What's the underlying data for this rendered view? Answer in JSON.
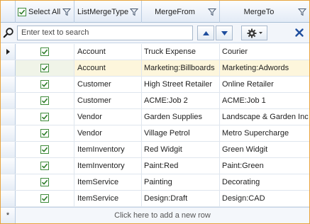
{
  "header": {
    "select_all_label": "Select All",
    "columns": [
      "ListMergeType",
      "MergeFrom",
      "MergeTo"
    ]
  },
  "search": {
    "placeholder": "Enter text to search"
  },
  "rows": [
    {
      "checked": true,
      "type": "Account",
      "from": "Truck Expense",
      "to": "Courier"
    },
    {
      "checked": true,
      "type": "Account",
      "from": "Marketing:Billboards",
      "to": "Marketing:Adwords"
    },
    {
      "checked": true,
      "type": "Customer",
      "from": "High Street Retailer",
      "to": "Online Retailer"
    },
    {
      "checked": true,
      "type": "Customer",
      "from": "ACME:Job 2",
      "to": "ACME:Job 1"
    },
    {
      "checked": true,
      "type": "Vendor",
      "from": "Garden Supplies",
      "to": "Landscape & Garden Inc"
    },
    {
      "checked": true,
      "type": "Vendor",
      "from": "Village Petrol",
      "to": "Metro Supercharge"
    },
    {
      "checked": true,
      "type": "ItemInventory",
      "from": "Red Widgit",
      "to": "Green Widgit"
    },
    {
      "checked": true,
      "type": "ItemInventory",
      "from": "Paint:Red",
      "to": "Paint:Green"
    },
    {
      "checked": true,
      "type": "ItemService",
      "from": "Painting",
      "to": "Decorating"
    },
    {
      "checked": true,
      "type": "ItemService",
      "from": "Design:Draft",
      "to": "Design:CAD"
    }
  ],
  "new_row": {
    "symbol": "*",
    "label": "Click here to add a new row"
  },
  "current_row_index": 1,
  "icons": {
    "search": "magnifier-icon",
    "filter": "funnel-icon",
    "up": "arrow-up-icon",
    "down": "arrow-down-icon",
    "settings": "gear-icon",
    "close": "close-x-icon"
  },
  "colors": {
    "border_accent": "#e8a33d",
    "current_row": "#fdf6dc",
    "check_green": "#3e8b3a",
    "nav_arrow": "#1f4e9e"
  }
}
